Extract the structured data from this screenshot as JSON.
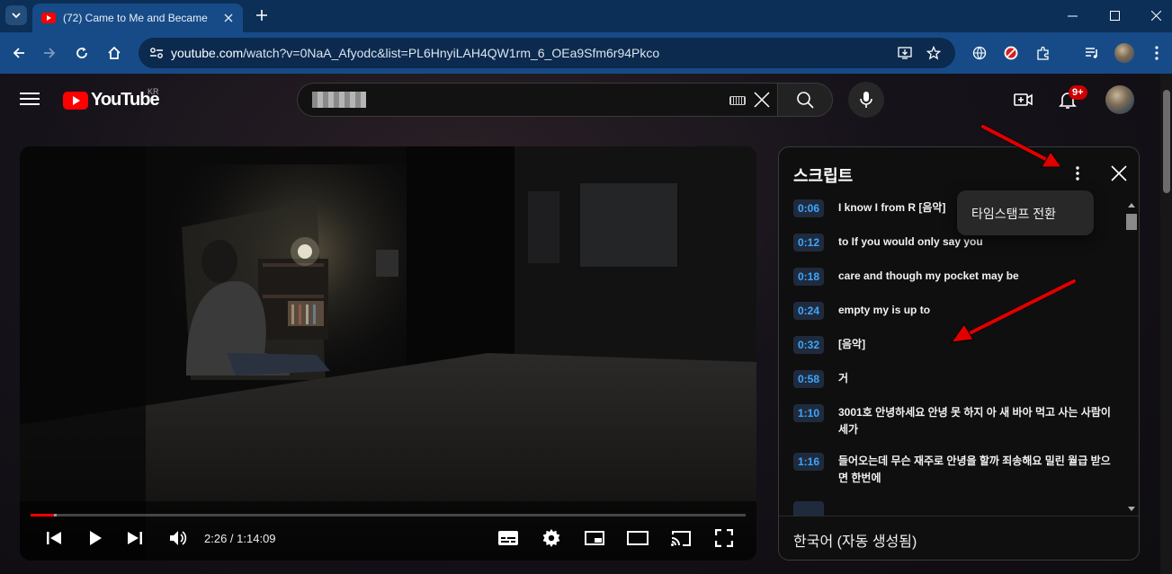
{
  "browser": {
    "tab_title": "(72) Came to Me and Became",
    "url_host": "youtube.com",
    "url_path": "/watch?v=0NaA_Afyodc&list=PL6HnyiLAH4QW1rm_6_OEa9Sfm6r94Pkco"
  },
  "youtube": {
    "logo_text": "YouTube",
    "region": "KR",
    "search_value": "",
    "notification_count": "9+"
  },
  "player": {
    "current_time": "2:26",
    "duration": "1:14:09",
    "time_separator": " / ",
    "progress_fraction": 0.0328,
    "buffered_fraction": 0.036
  },
  "transcript": {
    "title": "스크립트",
    "popup_item": "타임스탬프 전환",
    "language": "한국어 (자동 생성됨)",
    "segments": [
      {
        "time": "0:06",
        "text": "I know I from R [음악]"
      },
      {
        "time": "0:12",
        "text": "to If you would only say you"
      },
      {
        "time": "0:18",
        "text": "care and though my pocket may be"
      },
      {
        "time": "0:24",
        "text": "empty my is up to"
      },
      {
        "time": "0:32",
        "text": "[음악]"
      },
      {
        "time": "0:58",
        "text": "거"
      },
      {
        "time": "1:10",
        "text": "3001호 안녕하세요 안녕 못 하지 아 새 바아 먹고 사는 사람이 세가"
      },
      {
        "time": "1:16",
        "text": "들어오는데 무슨 재주로 안녕을 할까 죄송해요 밀린 월급 받으면 한번에"
      },
      {
        "time": "",
        "text": ""
      }
    ]
  },
  "colors": {
    "accent_blue": "#3ea6ff",
    "youtube_red": "#ff0000",
    "annotation_red": "#e00000",
    "chrome_frame": "#174b87"
  },
  "icons": [
    "tab-search-icon",
    "close-icon",
    "plus-icon",
    "minimize-icon",
    "maximize-icon",
    "back-icon",
    "forward-icon",
    "reload-icon",
    "home-icon",
    "site-info-icon",
    "install-icon",
    "star-icon",
    "globe-icon",
    "extension-icon",
    "puzzle-icon",
    "media-icon",
    "profile-icon",
    "menu-icon",
    "keyboard-icon",
    "search-icon",
    "mic-icon",
    "create-icon",
    "bell-icon",
    "prev-icon",
    "play-icon",
    "next-icon",
    "volume-icon",
    "subtitles-icon",
    "settings-icon",
    "miniplayer-icon",
    "theater-icon",
    "cast-icon",
    "fullscreen-icon",
    "more-vert-icon"
  ]
}
